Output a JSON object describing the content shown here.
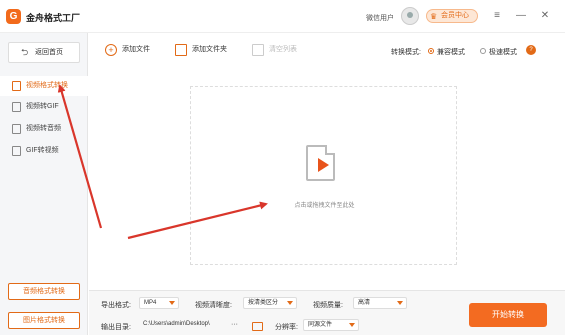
{
  "titlebar": {
    "logo_text": "G",
    "app_title": "金舟格式工厂",
    "user_name": "微信用户",
    "member_button": "会员中心",
    "controls": [
      "≡",
      "—",
      "✕"
    ]
  },
  "sidebar": {
    "back_label": "返回首页",
    "items": [
      {
        "label": "视频格式转换",
        "active": true
      },
      {
        "label": "视频转GIF",
        "active": false
      },
      {
        "label": "视频转音频",
        "active": false
      },
      {
        "label": "GIF转视频",
        "active": false
      }
    ],
    "bottom_buttons": [
      "音频格式转换",
      "图片格式转换"
    ]
  },
  "toolbar": {
    "add_file": "添加文件",
    "add_folder": "添加文件夹",
    "clear_list": "清空列表",
    "mode_label": "转换模式:",
    "mode_options": [
      {
        "label": "兼容模式",
        "checked": true
      },
      {
        "label": "极速模式",
        "checked": false
      }
    ]
  },
  "dropzone": {
    "hint": "点击或拖拽文件至此处"
  },
  "bottom": {
    "output_format_label": "导出格式:",
    "output_format_value": "MP4",
    "resolution_label": "视频清晰度:",
    "resolution_value": "按清类区分",
    "quality_label": "视频质量:",
    "quality_value": "高清",
    "output_dir_label": "输出目录:",
    "output_dir_value": "C:\\Users\\admin\\Desktop\\",
    "output_dir_more": "···",
    "ratio_label": "分辨率:",
    "ratio_value": "同源文件",
    "start_button": "开始转换"
  },
  "colors": {
    "accent": "#f36b21",
    "annotation_arrow": "#d9362b"
  }
}
